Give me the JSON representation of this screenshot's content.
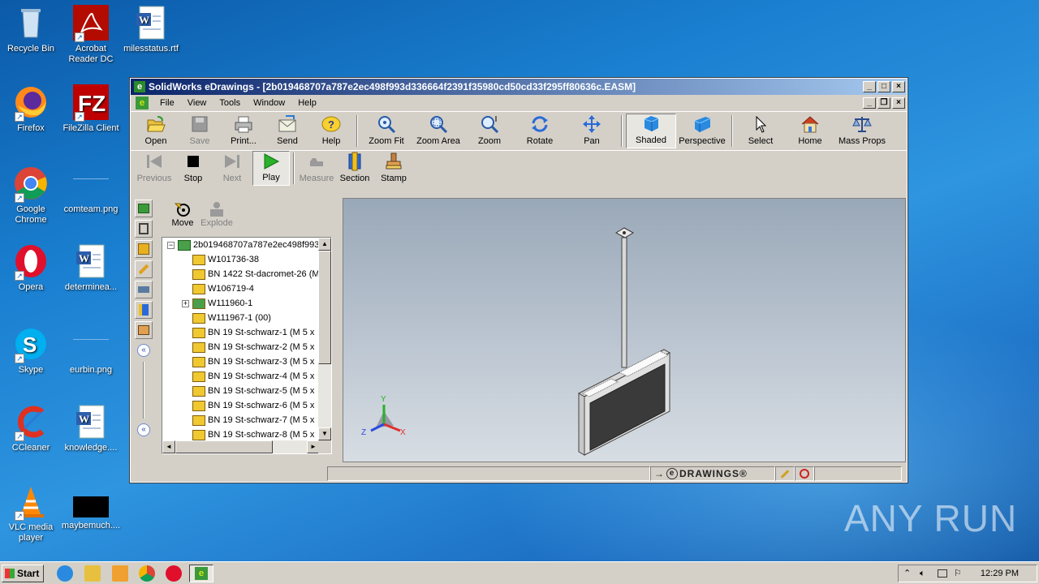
{
  "desktop": {
    "icons": [
      {
        "label": "Recycle Bin"
      },
      {
        "label": "Acrobat Reader DC"
      },
      {
        "label": "milesstatus.rtf"
      },
      {
        "label": "Firefox"
      },
      {
        "label": "FileZilla Client"
      },
      {
        "label": "Google Chrome"
      },
      {
        "label": "comteam.png"
      },
      {
        "label": "Opera"
      },
      {
        "label": "determinea..."
      },
      {
        "label": "Skype"
      },
      {
        "label": "eurbin.png"
      },
      {
        "label": "CCleaner"
      },
      {
        "label": "knowledge...."
      },
      {
        "label": "VLC media player"
      },
      {
        "label": "maybemuch...."
      }
    ],
    "watermark": "ANY RUN"
  },
  "window": {
    "title": "SolidWorks eDrawings - [2b019468707a787e2ec498f993d336664f2391f35980cd50cd33f295ff80636c.EASM]",
    "menu": [
      "File",
      "View",
      "Tools",
      "Window",
      "Help"
    ],
    "toolbar1": [
      {
        "label": "Open",
        "icon": "open-folder-icon"
      },
      {
        "label": "Save",
        "icon": "save-icon"
      },
      {
        "label": "Print...",
        "icon": "print-icon"
      },
      {
        "label": "Send",
        "icon": "send-icon"
      },
      {
        "label": "Help",
        "icon": "help-icon"
      },
      {
        "label": "Zoom Fit",
        "icon": "zoom-fit-icon"
      },
      {
        "label": "Zoom Area",
        "icon": "zoom-area-icon"
      },
      {
        "label": "Zoom",
        "icon": "zoom-icon"
      },
      {
        "label": "Rotate",
        "icon": "rotate-icon"
      },
      {
        "label": "Pan",
        "icon": "pan-icon"
      },
      {
        "label": "Shaded",
        "icon": "shaded-cube-icon"
      },
      {
        "label": "Perspective",
        "icon": "perspective-cube-icon"
      },
      {
        "label": "Select",
        "icon": "cursor-icon"
      },
      {
        "label": "Home",
        "icon": "home-icon"
      },
      {
        "label": "Mass Props",
        "icon": "scale-icon"
      }
    ],
    "toolbar2": [
      {
        "label": "Previous"
      },
      {
        "label": "Stop"
      },
      {
        "label": "Next"
      },
      {
        "label": "Play"
      },
      {
        "label": "Measure"
      },
      {
        "label": "Section"
      },
      {
        "label": "Stamp"
      }
    ],
    "panel_tools": {
      "move": "Move",
      "explode": "Explode"
    },
    "tree": {
      "root": "2b019468707a787e2ec498f993",
      "items": [
        "W101736-38",
        "BN 1422 St-dacromet-26 (M",
        "W106719-4",
        "W111960-1",
        "W111967-1 (00)",
        "BN 19 St-schwarz-1 (M 5 x",
        "BN 19 St-schwarz-2 (M 5 x",
        "BN 19 St-schwarz-3 (M 5 x",
        "BN 19 St-schwarz-4 (M 5 x",
        "BN 19 St-schwarz-5 (M 5 x",
        "BN 19 St-schwarz-6 (M 5 x",
        "BN 19 St-schwarz-7 (M 5 x",
        "BN 19 St-schwarz-8 (M 5 x"
      ]
    },
    "axes": {
      "x": "X",
      "y": "Y",
      "z": "Z"
    },
    "status_logo": "DRAWINGS®"
  },
  "taskbar": {
    "start": "Start",
    "clock": "12:29 PM"
  }
}
